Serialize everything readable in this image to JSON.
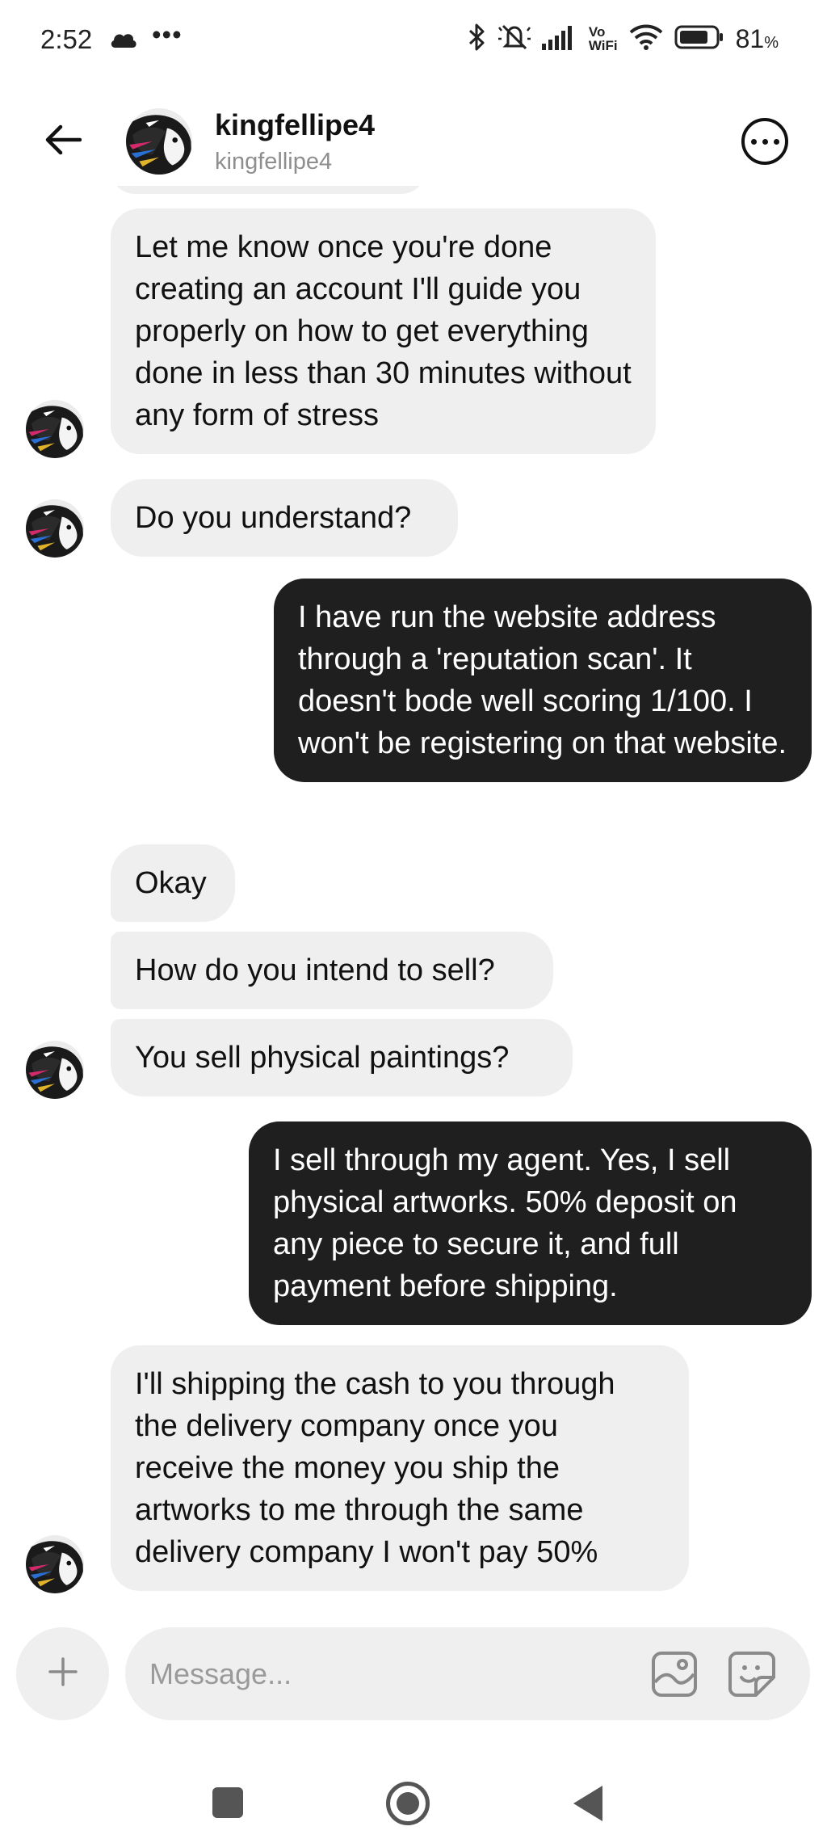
{
  "status_bar": {
    "time": "2:52",
    "more": "•••",
    "network_label_top": "Vo",
    "network_label_bottom": "WiFi",
    "battery_percent": "81",
    "battery_unit": "%",
    "battery_level": 81
  },
  "header": {
    "name": "kingfellipe4",
    "username": "kingfellipe4"
  },
  "messages": [
    {
      "from": "them",
      "text": "Let me know once you're done creating an account I'll guide you properly on how to get everything done in less than 30 minutes without any form of stress"
    },
    {
      "from": "them",
      "text": "Do you understand?"
    },
    {
      "from": "me",
      "text": "I have run the website address through a 'reputation scan'. It doesn't bode well scoring 1/100. I won't be registering on that website."
    },
    {
      "from": "them",
      "text": "Okay"
    },
    {
      "from": "them",
      "text": "How do you intend to sell?"
    },
    {
      "from": "them",
      "text": "You sell physical paintings?"
    },
    {
      "from": "me",
      "text": "I sell through my agent. Yes, I sell physical artworks. 50% deposit on any piece to secure it, and full payment before shipping."
    },
    {
      "from": "them",
      "text": "I'll shipping the cash to you through the delivery company once you receive the money you ship the artworks to me through the same delivery company I won't pay 50%"
    }
  ],
  "composer": {
    "placeholder": "Message..."
  },
  "icons": {
    "back": "arrow-left-icon",
    "more": "more-horizontal-icon",
    "add": "plus-icon",
    "gallery": "image-icon",
    "sticker": "sticker-icon",
    "nav_recents": "square-icon",
    "nav_home": "circle-icon",
    "nav_back": "triangle-back-icon"
  },
  "colors": {
    "incoming_bubble": "#efefef",
    "outgoing_bubble": "#1f1f1f",
    "subtle_text": "#8e8e8e"
  }
}
